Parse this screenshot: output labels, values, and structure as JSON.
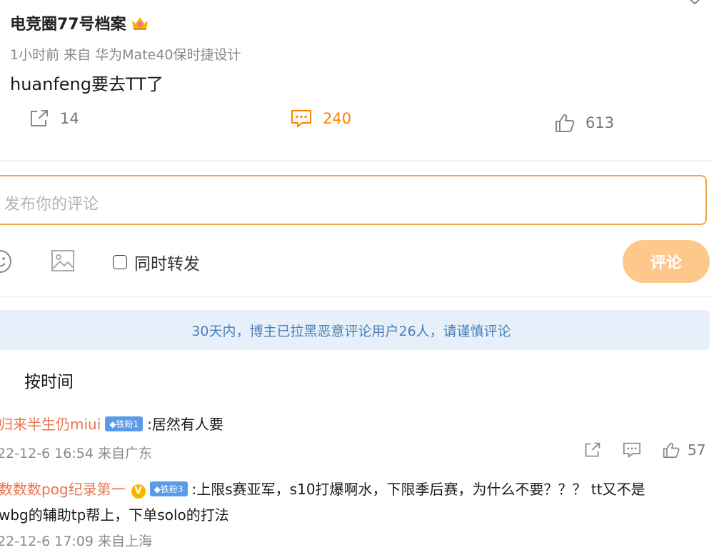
{
  "post": {
    "author": "电竞圈77号档案",
    "time_source": "1小时前  来自 华为Mate40保时捷设计",
    "text": "huanfeng要去TT了",
    "share_count": "14",
    "comment_count": "240",
    "like_count": "613"
  },
  "composer": {
    "placeholder": "发布你的评论",
    "repost_label": "同时转发",
    "submit_label": "评论"
  },
  "notice": "30天内，博主已拉黑恶意评论用户26人，请谨慎评论",
  "sort_label": "按时间",
  "comments": [
    {
      "user": "归来半生仍miui",
      "fan_badge": "铁粉1",
      "text": ":居然有人要",
      "meta": "22-12-6 16:54 来自广东",
      "like_count": "57"
    },
    {
      "user": "数数数pog纪录第一",
      "fan_badge": "铁粉3",
      "text": ":上限s赛亚军，s10打爆啊水，下限季后赛，为什么不要？？？ tt又不是",
      "text_line2": "wbg的辅助tp帮上，下单solo的打法",
      "meta": "22-12-6 17:09 来自上海"
    }
  ],
  "colors": {
    "accent": "#ff8200",
    "input_border": "#f5a54b",
    "submit_bg": "#ffc88b",
    "username": "#eb7350",
    "notice_bg": "#e7f0fa",
    "notice_text": "#4a7fb5"
  }
}
